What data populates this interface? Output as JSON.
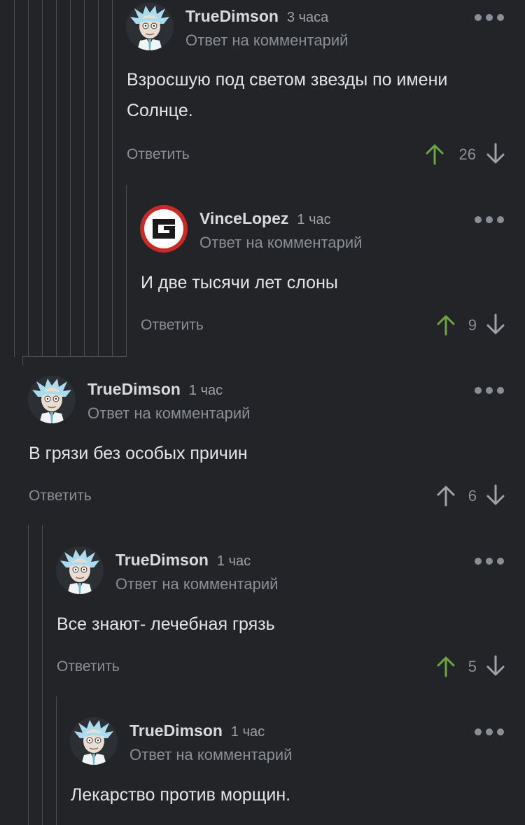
{
  "colors": {
    "background": "#222427",
    "thread_line": "#4b4e53",
    "upvote_active": "#6ba642",
    "upvote_inactive": "#9fa2a7"
  },
  "comments": [
    {
      "username": "TrueDimson",
      "time": "3 часа",
      "reply_to": "Ответ на комментарий",
      "text_lines": [
        "Взросшую под светом звезды по имени",
        "Солнце."
      ],
      "reply_label": "Ответить",
      "score": "26",
      "upvoted": true,
      "avatar": "rick-avatar"
    },
    {
      "username": "VinceLopez",
      "time": "1 час",
      "reply_to": "Ответ на комментарий",
      "text_lines": [
        "И две тысячи лет слоны"
      ],
      "reply_label": "Ответить",
      "score": "9",
      "upvoted": true,
      "avatar": "g-logo-avatar"
    },
    {
      "username": "TrueDimson",
      "time": "1 час",
      "reply_to": "Ответ на комментарий",
      "text_lines": [
        "В грязи без особых причин"
      ],
      "reply_label": "Ответить",
      "score": "6",
      "upvoted": false,
      "avatar": "rick-avatar"
    },
    {
      "username": "TrueDimson",
      "time": "1 час",
      "reply_to": "Ответ на комментарий",
      "text_lines": [
        "Все знают- лечебная грязь"
      ],
      "reply_label": "Ответить",
      "score": "5",
      "upvoted": true,
      "avatar": "rick-avatar"
    },
    {
      "username": "TrueDimson",
      "time": "1 час",
      "reply_to": "Ответ на комментарий",
      "text_lines": [
        "Лекарство против морщин."
      ],
      "avatar": "rick-avatar"
    }
  ]
}
